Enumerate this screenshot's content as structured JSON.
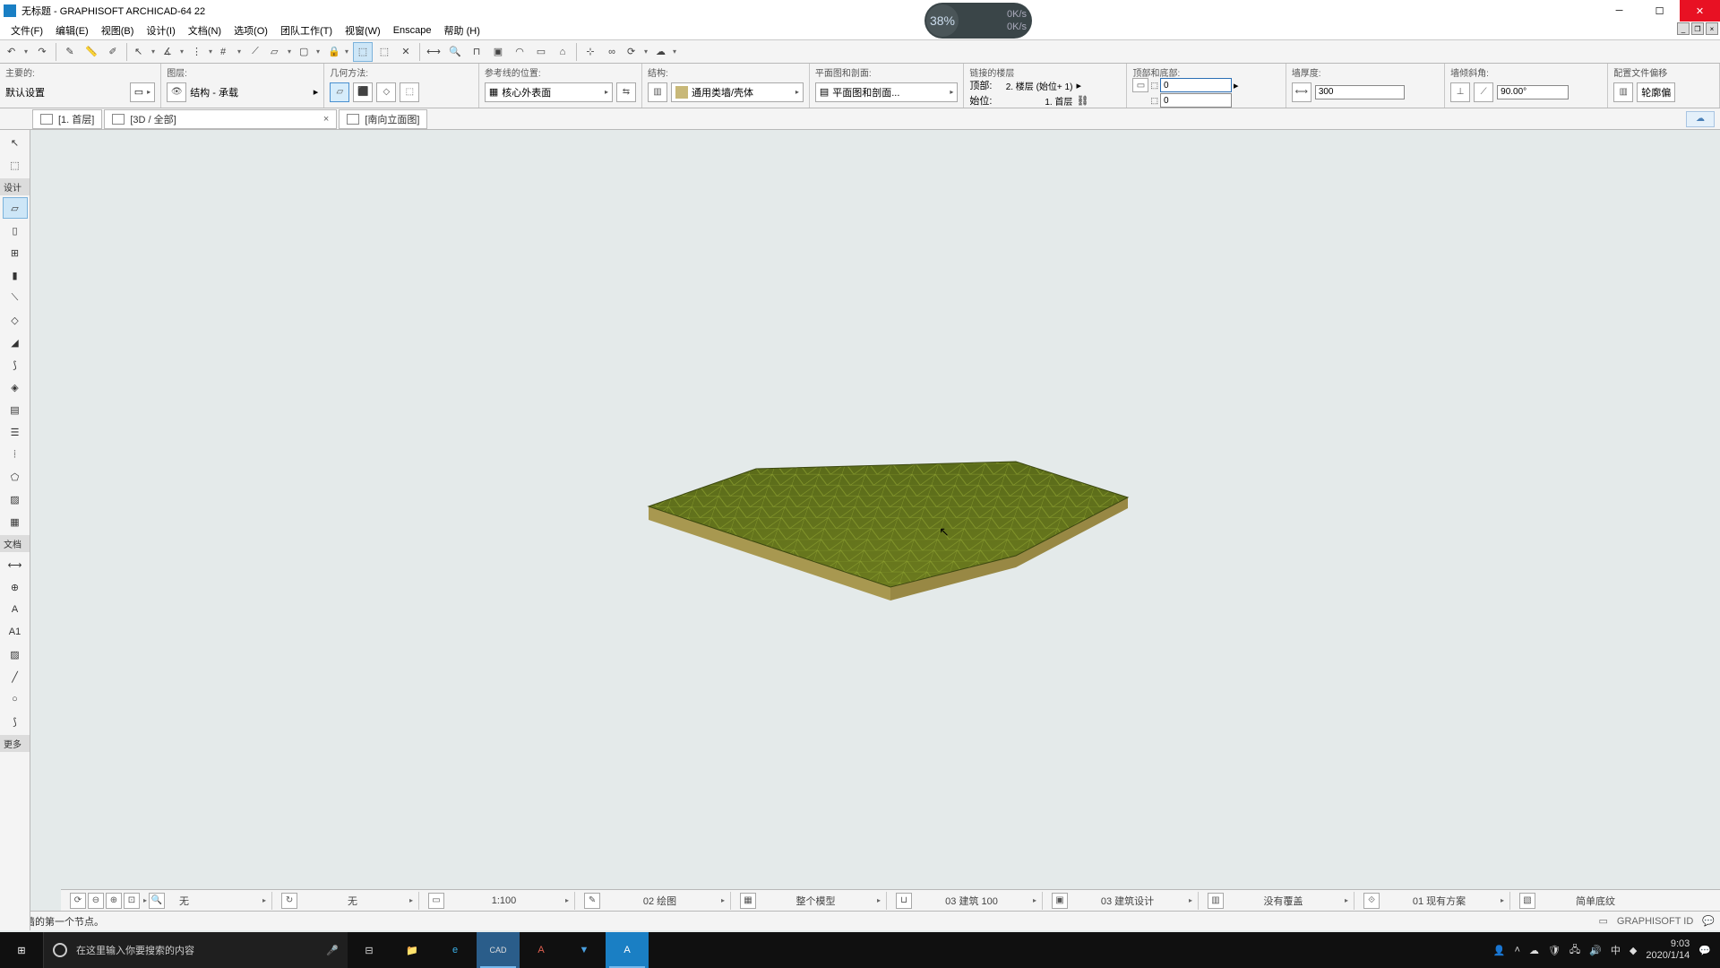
{
  "title": "无标题 - GRAPHISOFT ARCHICAD-64 22",
  "menu": [
    "文件(F)",
    "编辑(E)",
    "视图(B)",
    "设计(I)",
    "文档(N)",
    "选项(O)",
    "团队工作(T)",
    "视窗(W)",
    "Enscape",
    "帮助 (H)"
  ],
  "perf": {
    "pct": "38%",
    "up": "0K/s",
    "down": "0K/s"
  },
  "info": {
    "g1_label": "主要的:",
    "g1_value": "默认设置",
    "g2_label": "图层:",
    "g2_value": "结构 - 承载",
    "g3_label": "几何方法:",
    "g4_label": "参考线的位置:",
    "g4_value": "核心外表面",
    "g5_label": "结构:",
    "g5_value": "通用类墙/壳体",
    "g6_label": "平面图和剖面:",
    "g6_value": "平面图和剖面...",
    "g7_label": "链接的楼层",
    "g7_top": "顶部:",
    "g7_top_val": "2. 楼层 (始位+ 1)",
    "g7_base": "始位:",
    "g7_base_val": "1. 首层",
    "g8_label": "顶部和底部:",
    "g8_v1": "0",
    "g8_v2": "0",
    "g9_label": "墙厚度:",
    "g9_value": "300",
    "g10_label": "墙倾斜角:",
    "g10_value": "90.00°",
    "g11_label": "配置文件偏移",
    "g11_btn": "轮廓偏"
  },
  "tabs": {
    "t1": "[1. 首层]",
    "t2": "[3D / 全部]",
    "t3": "[南向立面图]"
  },
  "palette": {
    "sec1": "设计",
    "sec2": "文档",
    "sec3": "更多"
  },
  "quick": {
    "q1": "无",
    "q2": "无",
    "q3": "1:100",
    "q4": "02 绘图",
    "q5": "整个模型",
    "q6": "03 建筑 100",
    "q7": "03 建筑设计",
    "q8": "没有覆盖",
    "q9": "01 现有方案",
    "q10": "简单底纹"
  },
  "status_text": "输入墙的第一个节点。",
  "status_right": "GRAPHISOFT ID",
  "taskbar": {
    "search_placeholder": "在这里输入你要搜索的内容",
    "time": "9:03",
    "date": "2020/1/14",
    "ime": "中"
  }
}
